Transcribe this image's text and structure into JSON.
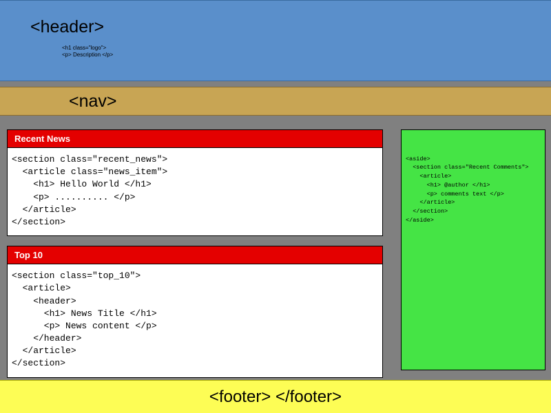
{
  "header": {
    "tag": "<header>",
    "sub_line1": "<h1 class=\"logo\">",
    "sub_line2": "<p> Description </p>"
  },
  "nav": {
    "tag": "<nav>"
  },
  "main": {
    "cards": [
      {
        "title": "Recent News",
        "body": "<section class=\"recent_news\">\n  <article class=\"news_item\">\n    <h1> Hello World </h1>\n    <p> .......... </p>\n  </article>\n</section>"
      },
      {
        "title": "Top 10",
        "body": "<section class=\"top_10\">\n  <article>\n    <header>\n      <h1> News Title </h1>\n      <p> News content </p>\n    </header>\n  </article>\n</section>"
      }
    ]
  },
  "aside": {
    "body": "<aside>\n  <section class=\"Recent Comments\">\n    <article>\n      <h1> @author </h1>\n      <p> comments text </p>\n    </article>\n  </section>\n</aside>"
  },
  "footer": {
    "tag": "<footer> </footer>"
  },
  "colors": {
    "header": "#5A8FCB",
    "nav": "#C8A554",
    "aside": "#45E445",
    "footer": "#FDFD55",
    "card_header": "#E40000",
    "page_bg": "#808080"
  }
}
